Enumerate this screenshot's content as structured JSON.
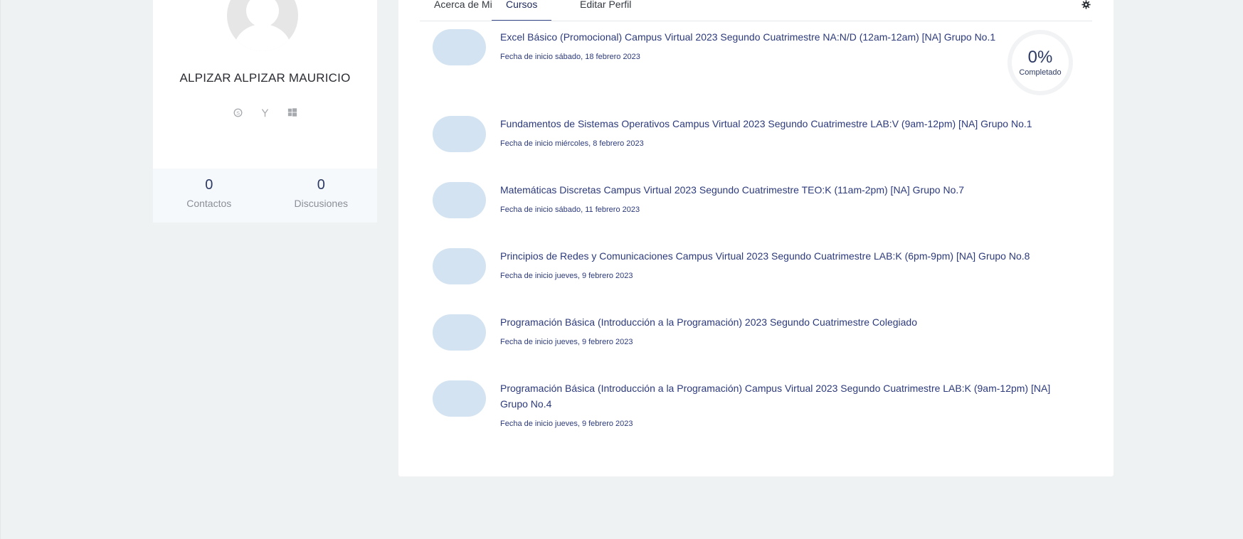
{
  "profile": {
    "name": "ALPIZAR ALPIZAR MAURICIO",
    "social_icons": [
      "skype-icon",
      "yahoo-icon",
      "windows-icon"
    ],
    "stats": [
      {
        "value": "0",
        "label": "Contactos"
      },
      {
        "value": "0",
        "label": "Discusiones"
      }
    ]
  },
  "tabs": {
    "about": "Acerca de Mi",
    "courses": "Cursos",
    "edit": "Editar Perfil",
    "active": "courses"
  },
  "courses": [
    {
      "title": "Excel Básico (Promocional) Campus Virtual 2023 Segundo Cuatrimestre NA:N/D (12am-12am) [NA] Grupo No.1",
      "date": "Fecha de inicio sábado, 18 febrero 2023",
      "progress": {
        "value": "0%",
        "label": "Completado"
      }
    },
    {
      "title": "Fundamentos de Sistemas Operativos Campus Virtual 2023 Segundo Cuatrimestre LAB:V (9am-12pm) [NA] Grupo No.1",
      "date": "Fecha de inicio miércoles, 8 febrero 2023"
    },
    {
      "title": "Matemáticas Discretas Campus Virtual 2023 Segundo Cuatrimestre TEO:K (11am-2pm) [NA] Grupo No.7",
      "date": "Fecha de inicio sábado, 11 febrero 2023"
    },
    {
      "title": "Principios de Redes y Comunicaciones Campus Virtual 2023 Segundo Cuatrimestre LAB:K (6pm-9pm) [NA] Grupo No.8",
      "date": "Fecha de inicio jueves, 9 febrero 2023"
    },
    {
      "title": "Programación Básica (Introducción a la Programación) 2023 Segundo Cuatrimestre Colegiado",
      "date": "Fecha de inicio jueves, 9 febrero 2023"
    },
    {
      "title": "Programación Básica (Introducción a la Programación) Campus Virtual 2023 Segundo Cuatrimestre LAB:K (9am-12pm) [NA] Grupo No.4",
      "date": "Fecha de inicio jueves, 9 febrero 2023"
    }
  ]
}
